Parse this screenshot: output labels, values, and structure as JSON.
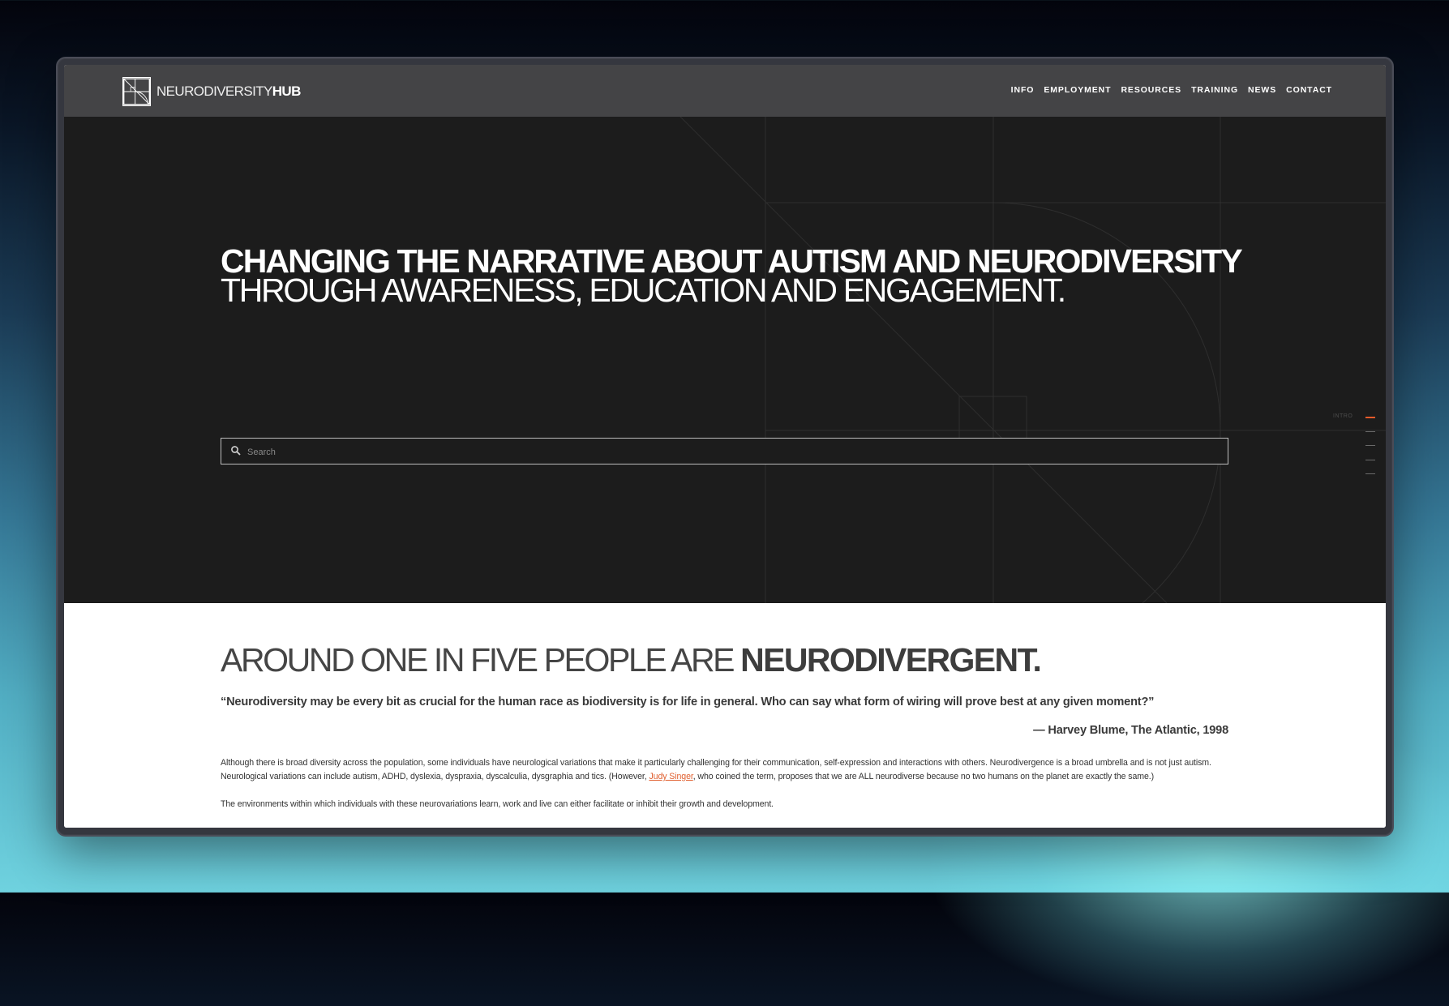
{
  "site": {
    "logo_text_light": "NEURODIVERSITY",
    "logo_text_bold": "HUB"
  },
  "nav": {
    "items": [
      {
        "label": "INFO"
      },
      {
        "label": "EMPLOYMENT"
      },
      {
        "label": "RESOURCES"
      },
      {
        "label": "TRAINING"
      },
      {
        "label": "NEWS"
      },
      {
        "label": "CONTACT"
      }
    ]
  },
  "hero": {
    "headline": "CHANGING THE NARRATIVE ABOUT AUTISM AND NEURODIVERSITY",
    "subline": "THROUGH AWARENESS, EDUCATION AND ENGAGEMENT.",
    "search_placeholder": "Search",
    "section_indicator_label": "INTRO"
  },
  "content": {
    "stat_light": "AROUND ONE IN FIVE PEOPLE ARE ",
    "stat_bold": "NEURODIVERGENT.",
    "quote": "“Neurodiversity may be every bit as crucial for the human race as biodiversity is for life in general. Who can say what form of wiring will prove best at any given moment?”",
    "attribution": "— Harvey Blume, The Atlantic, 1998",
    "para1_before": "Although there is broad diversity across the population, some individuals have neurological variations that make it particularly challenging for their communication, self-expression and interactions with others. Neurodivergence is a broad umbrella and is not just autism. Neurological variations can include autism, ADHD, dyslexia, dyspraxia, dyscalculia, dysgraphia and tics. (However, ",
    "para1_link": "Judy Singer",
    "para1_after": ", who coined the term, proposes that we are ALL neurodiverse because no two humans on the planet are exactly the same.)",
    "para2": "The environments within which individuals with these neurovariations learn, work and live can either facilitate or inhibit their growth and development."
  },
  "colors": {
    "nav_bg": "#444446",
    "hero_bg": "#1c1c1c",
    "accent": "#e06030",
    "text_dark": "#3a3a3a"
  },
  "icons": {
    "search": "search-icon",
    "logo": "logo-mark-icon"
  }
}
